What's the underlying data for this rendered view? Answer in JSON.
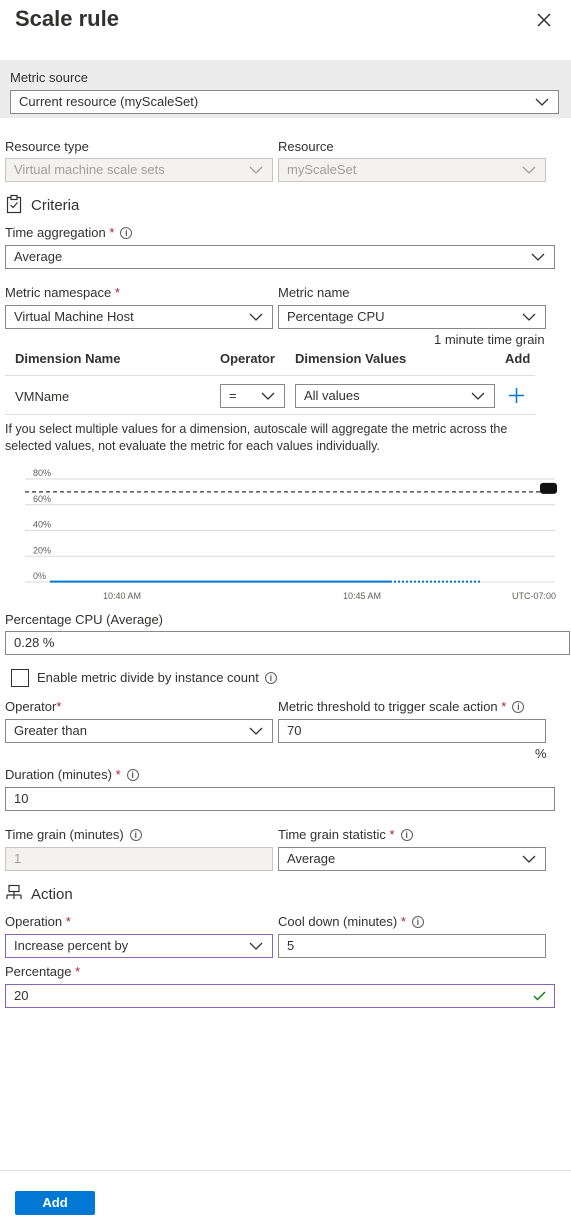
{
  "header": {
    "title": "Scale rule"
  },
  "metric_source": {
    "label": "Metric source",
    "value": "Current resource (myScaleSet)"
  },
  "resource_type": {
    "label": "Resource type",
    "value": "Virtual machine scale sets"
  },
  "resource": {
    "label": "Resource",
    "value": "myScaleSet"
  },
  "criteria": {
    "heading": "Criteria",
    "time_aggregation": {
      "label": "Time aggregation",
      "value": "Average"
    },
    "metric_namespace": {
      "label": "Metric namespace",
      "value": "Virtual Machine Host"
    },
    "metric_name": {
      "label": "Metric name",
      "value": "Percentage CPU"
    },
    "time_grain_note": "1 minute time grain"
  },
  "dimensions": {
    "headers": {
      "name": "Dimension Name",
      "operator": "Operator",
      "values": "Dimension Values",
      "add": "Add"
    },
    "row": {
      "name": "VMName",
      "operator": "=",
      "values": "All values"
    },
    "note": "If you select multiple values for a dimension, autoscale will aggregate the metric across the selected values, not evaluate the metric for each values individually."
  },
  "chart_data": {
    "type": "line",
    "y_ticks": [
      "80%",
      "60%",
      "40%",
      "20%",
      "0%"
    ],
    "ylim": [
      0,
      80
    ],
    "x_ticks": [
      "10:40 AM",
      "10:45 AM"
    ],
    "timezone": "UTC-07:00",
    "threshold": 70,
    "series": [
      {
        "values": [
          0.28,
          0.28,
          0.3,
          0.28,
          0.28,
          0.28
        ],
        "color": "#0078d4"
      }
    ]
  },
  "metric_value": {
    "label": "Percentage CPU (Average)",
    "value": "0.28 %"
  },
  "divide_checkbox": {
    "label": "Enable metric divide by instance count",
    "checked": false
  },
  "operator": {
    "label": "Operator",
    "value": "Greater than"
  },
  "threshold": {
    "label": "Metric threshold to trigger scale action",
    "value": "70",
    "unit": "%"
  },
  "duration": {
    "label": "Duration (minutes)",
    "value": "10"
  },
  "time_grain": {
    "label": "Time grain (minutes)",
    "value": "1"
  },
  "time_grain_statistic": {
    "label": "Time grain statistic",
    "value": "Average"
  },
  "action": {
    "heading": "Action",
    "operation": {
      "label": "Operation",
      "value": "Increase percent by"
    },
    "cool_down": {
      "label": "Cool down (minutes)",
      "value": "5"
    },
    "percentage": {
      "label": "Percentage",
      "value": "20"
    }
  },
  "footer": {
    "add_label": "Add"
  },
  "colors": {
    "accent": "#0078d4",
    "required": "#a4262c",
    "focus_border": "#8764b8"
  }
}
